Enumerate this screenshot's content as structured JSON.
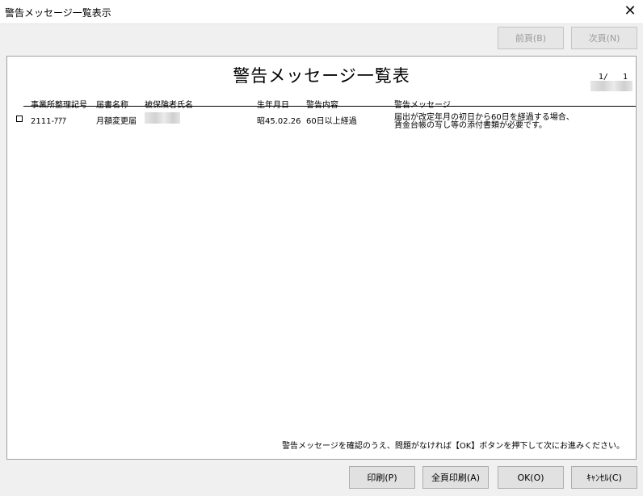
{
  "window": {
    "title": "警告メッセージ一覧表示",
    "close_glyph": "✕"
  },
  "toolbar": {
    "prev_label": "前頁(B)",
    "next_label": "次頁(N)"
  },
  "report": {
    "title": "警告メッセージ一覧表",
    "page_current": "1/",
    "page_total": "1",
    "columns": {
      "office_code": "事業所整理記号",
      "form_name": "届書名称",
      "insured_name": "被保険者氏名",
      "birth_date": "生年月日",
      "warning_type": "警告内容",
      "warning_message": "警告メッセージ"
    },
    "rows": [
      {
        "office_code": "2111-ｱｱｱ",
        "form_name": "月額変更届",
        "birth_date": "昭45.02.26",
        "warning_type": "60日以上経過",
        "message_line1": "届出が改定年月の初日から60日を経過する場合、",
        "message_line2": "賃金台帳の写し等の添付書類が必要です。"
      }
    ],
    "footer_note": "警告メッセージを確認のうえ、問題がなければ【OK】ボタンを押下して次にお進みください。"
  },
  "buttons": {
    "print": "印刷(P)",
    "print_all": "全頁印刷(A)",
    "ok": "OK(O)",
    "cancel": "ｷｬﾝｾﾙ(C)"
  }
}
